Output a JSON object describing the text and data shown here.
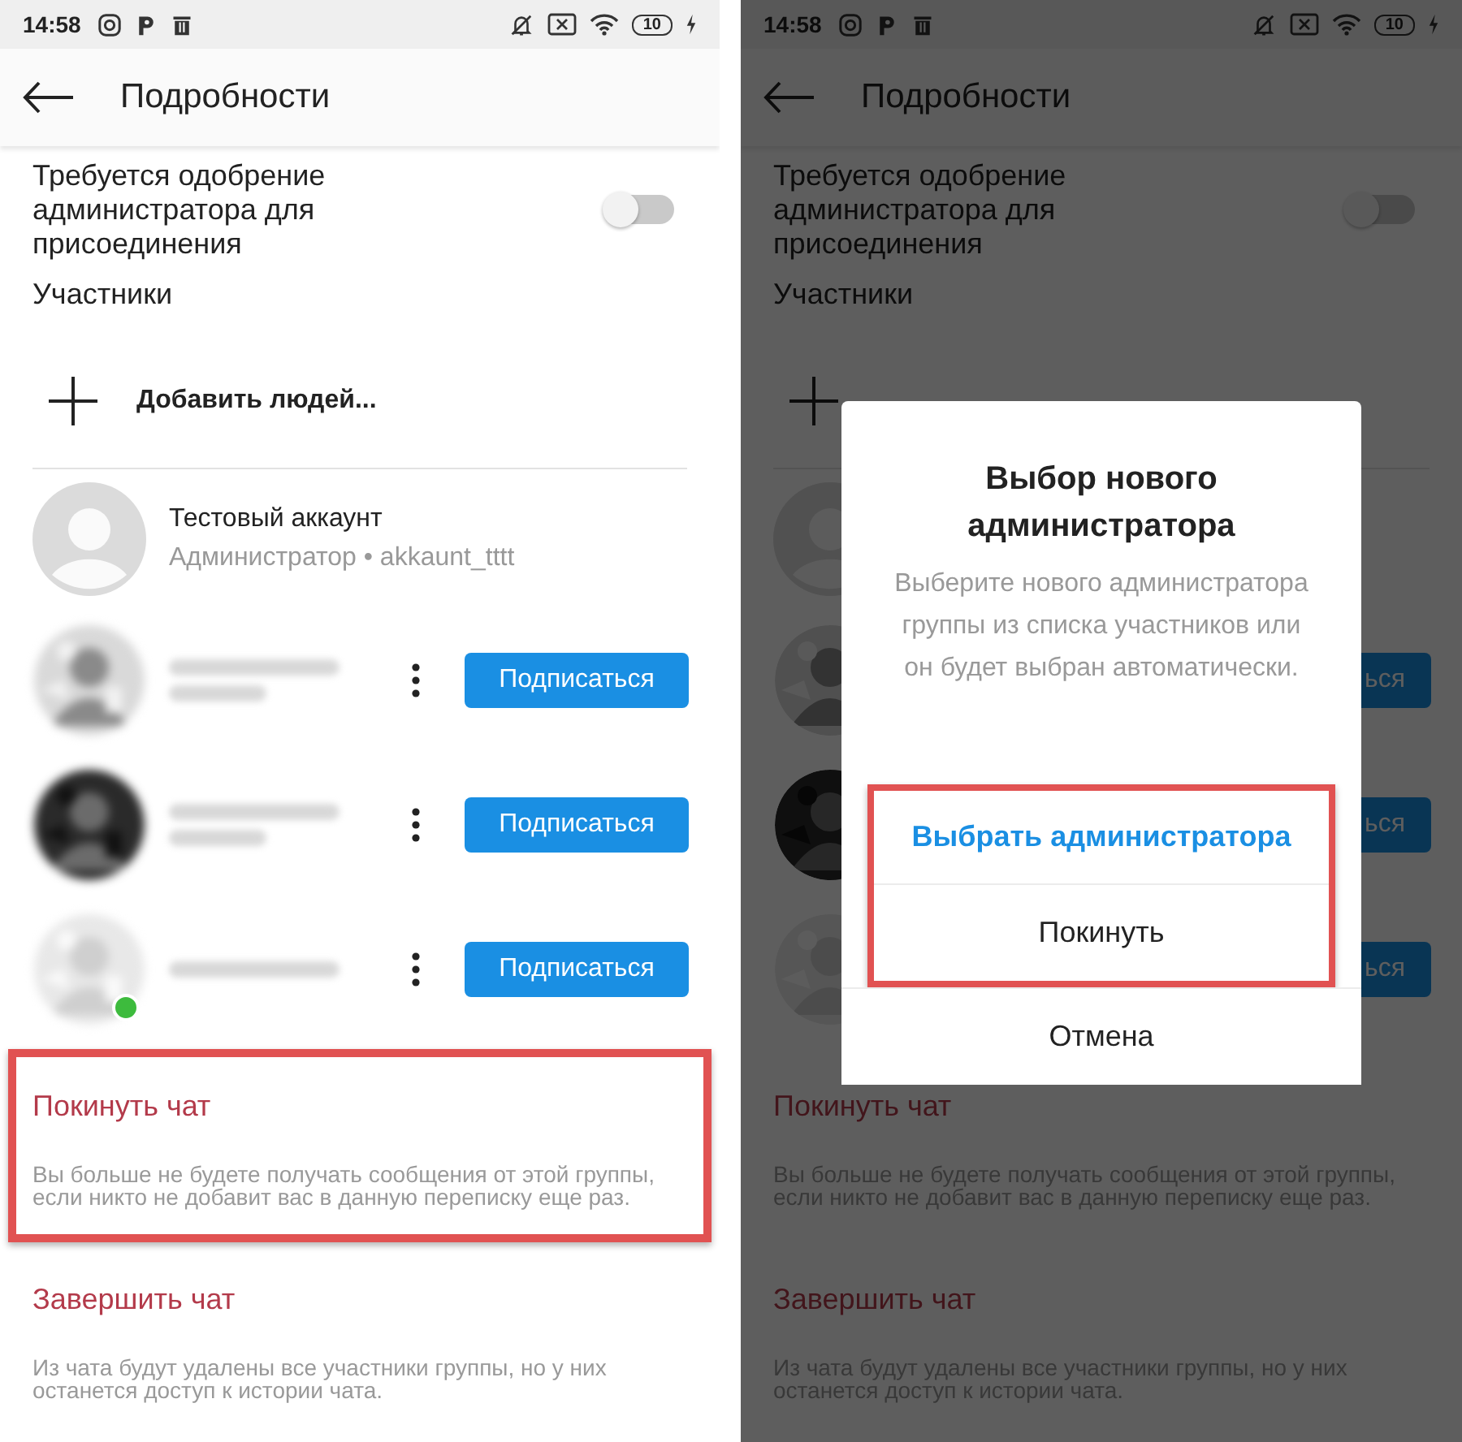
{
  "screens": [
    {
      "redacted": true,
      "status_bar": {
        "time": "14:58",
        "battery": "10"
      },
      "header": {
        "title": "Подробности"
      },
      "approval": {
        "label": "Требуется одобрение администратора для присоединения",
        "on": false
      },
      "members_heading": "Участники",
      "add_people": {
        "kind": "full",
        "label": "Добавить людей..."
      },
      "members": [
        {
          "kind": "self",
          "name": "Тестовый аккаунт",
          "subtitle": "Администратор • akkaunt_tttt"
        },
        {
          "kind": "other",
          "follow": "Подписаться",
          "menu": true,
          "online": false,
          "second_line": true
        },
        {
          "kind": "other",
          "follow": "Подписаться",
          "menu": true,
          "online": false,
          "second_line": true
        },
        {
          "kind": "other",
          "follow": "Подписаться",
          "menu": true,
          "online": true,
          "second_line": false
        }
      ],
      "sections": [
        {
          "title": "Покинуть чат",
          "description": "Вы больше не будете получать сообщения от этой группы, если никто не добавит вас в данную переписку еще раз.",
          "highlighted": true
        },
        {
          "title": "Завершить чат",
          "description": "Из чата будут удалены все участники группы, но у них останется доступ к истории чата.",
          "highlighted": false
        }
      ]
    },
    {
      "redacted": false,
      "status_bar": {
        "time": "14:58",
        "battery": "10"
      },
      "header": {
        "title": "Подробности"
      },
      "approval": {
        "label": "Требуется одобрение администратора для присоединения",
        "on": false
      },
      "members_heading": "Участники",
      "add_people": {
        "kind": "covered"
      },
      "members": [
        {
          "kind": "self"
        },
        {
          "kind": "other",
          "follow": "ься",
          "menu": false,
          "online": false
        },
        {
          "kind": "other",
          "follow": "ься",
          "menu": false,
          "online": false
        },
        {
          "kind": "other",
          "follow": "ься",
          "menu": false,
          "online": false
        }
      ],
      "sections": [
        {
          "title": "Покинуть чат",
          "description": "Вы больше не будете получать сообщения от этой группы, если никто не добавит вас в данную переписку еще раз.",
          "highlighted": false
        },
        {
          "title": "Завершить чат",
          "description": "Из чата будут удалены все участники группы, но у них останется доступ к истории чата.",
          "highlighted": false
        }
      ],
      "dialog": {
        "title": "Выбор нового администратора",
        "message": "Выберите нового администратора группы из списка участников или он будет выбран автоматически.",
        "actions": [
          {
            "label": "Выбрать администратора",
            "kind": "primary",
            "highlighted": true
          },
          {
            "label": "Покинуть",
            "kind": "plain",
            "highlighted": true
          },
          {
            "label": "Отмена",
            "kind": "plain",
            "highlighted": false
          }
        ]
      }
    }
  ]
}
